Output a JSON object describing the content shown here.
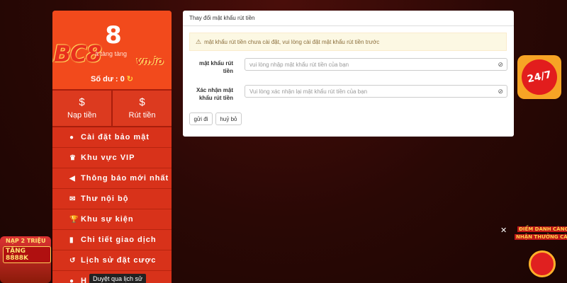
{
  "sidebar": {
    "avatar_glyph": "8",
    "logo": "ABC8",
    "logo_suffix": "vn.io",
    "username_hint": "à tàng tàng",
    "balance_label": "Số dư :",
    "balance_value": "0",
    "actions": [
      {
        "label": "Nạp tiền",
        "icon": "dollar-coin-icon",
        "glyph": "$"
      },
      {
        "label": "Rút tiền",
        "icon": "withdraw-icon",
        "glyph": "$"
      }
    ],
    "menu": [
      {
        "label": "Cài đặt bảo mật",
        "icon": "user-shield-icon",
        "glyph": "●"
      },
      {
        "label": "Khu vực VIP",
        "icon": "crown-icon",
        "glyph": "♛"
      },
      {
        "label": "Thông báo mới nhất",
        "icon": "megaphone-icon",
        "glyph": "◀"
      },
      {
        "label": "Thư nội bộ",
        "icon": "envelope-icon",
        "glyph": "✉"
      },
      {
        "label": "Khu sự kiện",
        "icon": "trophy-icon",
        "glyph": "🏆"
      },
      {
        "label": "Chi tiết giao dịch",
        "icon": "clipboard-icon",
        "glyph": "▮"
      },
      {
        "label": "Lịch sử đặt cược",
        "icon": "history-icon",
        "glyph": "↺"
      },
      {
        "label": "H",
        "icon": "help-icon",
        "glyph": "●"
      }
    ],
    "tooltip": "Duyệt qua lịch sử"
  },
  "panel": {
    "title": "Thay đổi mật khẩu rút tiền",
    "alert": "mật khẩu rút tiền chưa cài đặt, vui lòng cài đặt mật khẩu rút tiền trước",
    "fields": [
      {
        "label": "mật khẩu rút tiền",
        "placeholder": "vui lòng nhập mật khẩu rút tiền của bạn"
      },
      {
        "label": "Xác nhận mật khẩu rút tiền",
        "placeholder": "Vui lòng xác nhận lại mật khẩu rút tiền của bạn"
      }
    ],
    "submit_label": "gửi đi",
    "cancel_label": "huỷ bỏ"
  },
  "widgets": {
    "support_label": "24/7",
    "promo_left_top": "NẠP 2 TRIỆU",
    "promo_left_main": "TẶNG 8888K",
    "promo_right_line1": "ĐIỂM DANH CÀNG NHIỀU",
    "promo_right_line2": "NHẬN THƯỞNG CÀNG CAO",
    "close_glyph": "✕"
  },
  "colors": {
    "sidebar_red": "#d8321a",
    "profile_orange": "#f24a1c",
    "alert_bg": "#fcf8e3",
    "background": "#2a0805"
  }
}
